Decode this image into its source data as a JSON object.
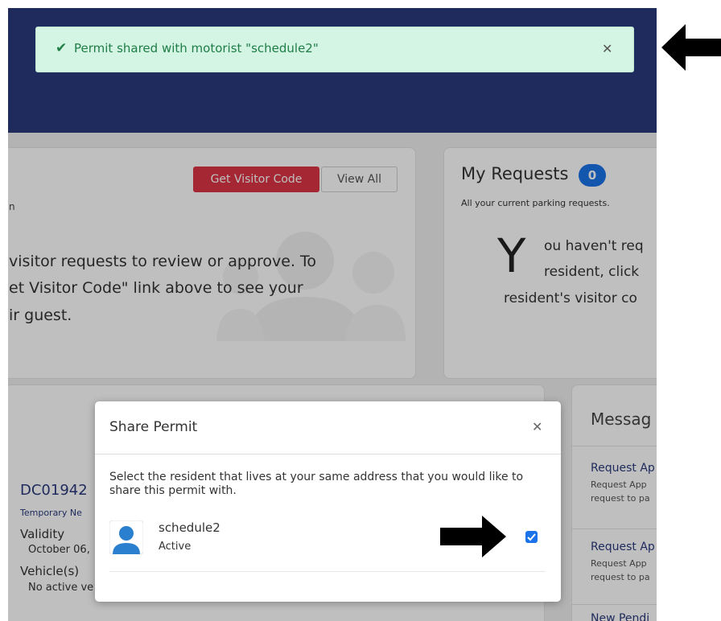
{
  "toast": {
    "message": "Permit shared with motorist \"schedule2\"",
    "check_icon": "✔",
    "close_icon": "✕"
  },
  "visitor_card": {
    "get_code_label": "Get Visitor Code",
    "view_all_label": "View All",
    "subtitle_fragment": "n",
    "empty_line1": "visitor requests to review or approve. To",
    "empty_line2": "et Visitor Code\" link above to see your",
    "empty_line3": "ir guest."
  },
  "requests_card": {
    "title": "My Requests",
    "count": "0",
    "subtitle": "All your current parking requests.",
    "big_letter": "Y",
    "line1": "ou haven't req",
    "line2": "resident, click",
    "line3": "resident's visitor co"
  },
  "permit_card": {
    "permit_id": "DC01942",
    "type": "Temporary Ne",
    "validity_label": "Validity",
    "validity_value": "October 06,",
    "vehicles_label": "Vehicle(s)",
    "vehicles_value": "No active ve"
  },
  "messages_card": {
    "title": "Messag",
    "items": [
      {
        "title": "Request Ap",
        "line1": "Request App",
        "line2": "request to pa"
      },
      {
        "title": "Request Ap",
        "line1": "Request App",
        "line2": "request to pa"
      },
      {
        "title": "New Pendi"
      }
    ]
  },
  "modal": {
    "title": "Share Permit",
    "close_icon": "✕",
    "instructions": "Select the resident that lives at your same address that you would like to share this permit with.",
    "resident": {
      "name": "schedule2",
      "status": "Active",
      "checked": true
    }
  },
  "colors": {
    "navy": "#2a3a7d",
    "red": "#dc3545",
    "toast_bg": "#d4f4e4",
    "toast_text": "#1e7e46",
    "checkbox": "#1a73e8"
  }
}
